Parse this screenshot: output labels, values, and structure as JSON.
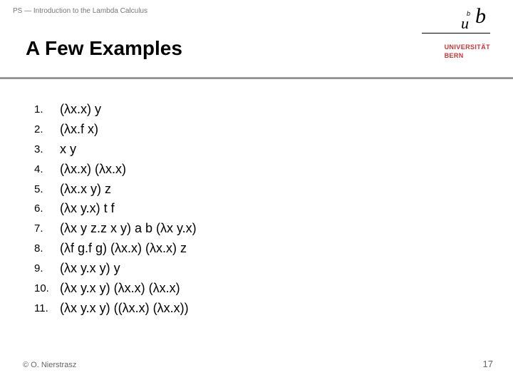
{
  "header": {
    "breadcrumb": "PS — Introduction to the Lambda Calculus",
    "title": "A Few Examples"
  },
  "logo": {
    "u": "u",
    "b": "b",
    "sup": "b",
    "university": "UNIVERSITÄT\nBERN"
  },
  "list": {
    "items": [
      {
        "n": "1.",
        "expr": "(λx.x) y"
      },
      {
        "n": "2.",
        "expr": "(λx.f x)"
      },
      {
        "n": "3.",
        "expr": "x y"
      },
      {
        "n": "4.",
        "expr": "(λx.x) (λx.x)"
      },
      {
        "n": "5.",
        "expr": "(λx.x y) z"
      },
      {
        "n": "6.",
        "expr": "(λx y.x) t f"
      },
      {
        "n": "7.",
        "expr": "(λx y z.z x y) a b (λx y.x)"
      },
      {
        "n": "8.",
        "expr": "(λf g.f g) (λx.x) (λx.x) z"
      },
      {
        "n": "9.",
        "expr": "(λx y.x y) y"
      },
      {
        "n": "10.",
        "expr": "(λx y.x y) (λx.x) (λx.x)"
      },
      {
        "n": "11.",
        "expr": "(λx y.x y) ((λx.x) (λx.x))"
      }
    ]
  },
  "footer": {
    "copyright": "© O. Nierstrasz",
    "page": "17"
  }
}
